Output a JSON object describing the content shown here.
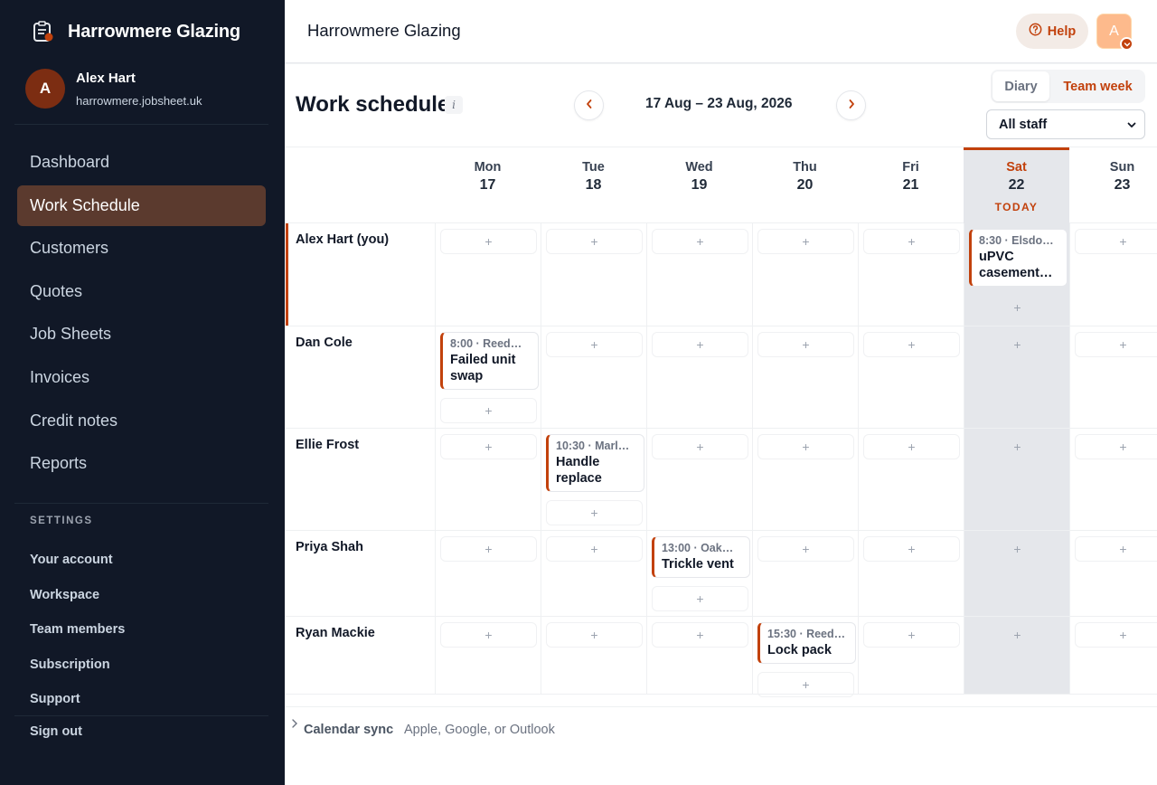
{
  "brand": {
    "name": "Harrowmere Glazing",
    "icon": "jobsheet-icon"
  },
  "user": {
    "initial": "A",
    "name": "Alex Hart",
    "domain": "harrowmere.jobsheet.uk"
  },
  "nav": {
    "items": [
      {
        "label": "Dashboard",
        "active": false
      },
      {
        "label": "Work Schedule",
        "active": true
      },
      {
        "label": "Customers",
        "active": false
      },
      {
        "label": "Quotes",
        "active": false
      },
      {
        "label": "Job Sheets",
        "active": false
      },
      {
        "label": "Invoices",
        "active": false
      },
      {
        "label": "Credit notes",
        "active": false
      },
      {
        "label": "Reports",
        "active": false
      }
    ]
  },
  "settings": {
    "heading": "SETTINGS",
    "items": [
      "Your account",
      "Workspace",
      "Team members",
      "Subscription",
      "Support"
    ]
  },
  "sign_out": "Sign out",
  "topbar": {
    "title": "Harrowmere Glazing",
    "help": "Help",
    "avatar_initial": "A"
  },
  "schedule": {
    "title": "Work schedule",
    "info": "i",
    "week_range": "17 Aug – 23 Aug, 2026",
    "views": {
      "diary": "Diary",
      "team_week": "Team week",
      "active": "team_week"
    },
    "staff_filter": "All staff",
    "days": [
      {
        "name": "Mon",
        "num": "17"
      },
      {
        "name": "Tue",
        "num": "18"
      },
      {
        "name": "Wed",
        "num": "19"
      },
      {
        "name": "Thu",
        "num": "20"
      },
      {
        "name": "Fri",
        "num": "21"
      },
      {
        "name": "Sat",
        "num": "22",
        "today": true,
        "today_label": "TODAY"
      },
      {
        "name": "Sun",
        "num": "23"
      }
    ],
    "add_glyph": "+",
    "staff": [
      {
        "name": "Alex Hart (you)",
        "jobs": [
          {
            "day": 5,
            "time": "8:30 · Elsdo…",
            "title": "uPVC casement…"
          }
        ]
      },
      {
        "name": "Dan Cole",
        "jobs": [
          {
            "day": 0,
            "time": "8:00 · Reed…",
            "title": "Failed unit swap"
          }
        ]
      },
      {
        "name": "Ellie Frost",
        "jobs": [
          {
            "day": 1,
            "time": "10:30 · Marl…",
            "title": "Handle replace"
          }
        ]
      },
      {
        "name": "Priya Shah",
        "jobs": [
          {
            "day": 2,
            "time": "13:00 · Oak…",
            "title": "Trickle vent"
          }
        ]
      },
      {
        "name": "Ryan Mackie",
        "jobs": [
          {
            "day": 3,
            "time": "15:30 · Reed…",
            "title": "Lock pack"
          }
        ]
      }
    ]
  },
  "calendar_sync": {
    "label": "Calendar sync",
    "sub": "Apple, Google, or Outlook"
  },
  "colors": {
    "accent": "#c2410c",
    "sidebar": "#111827",
    "active_nav": "#5b3a2e"
  }
}
